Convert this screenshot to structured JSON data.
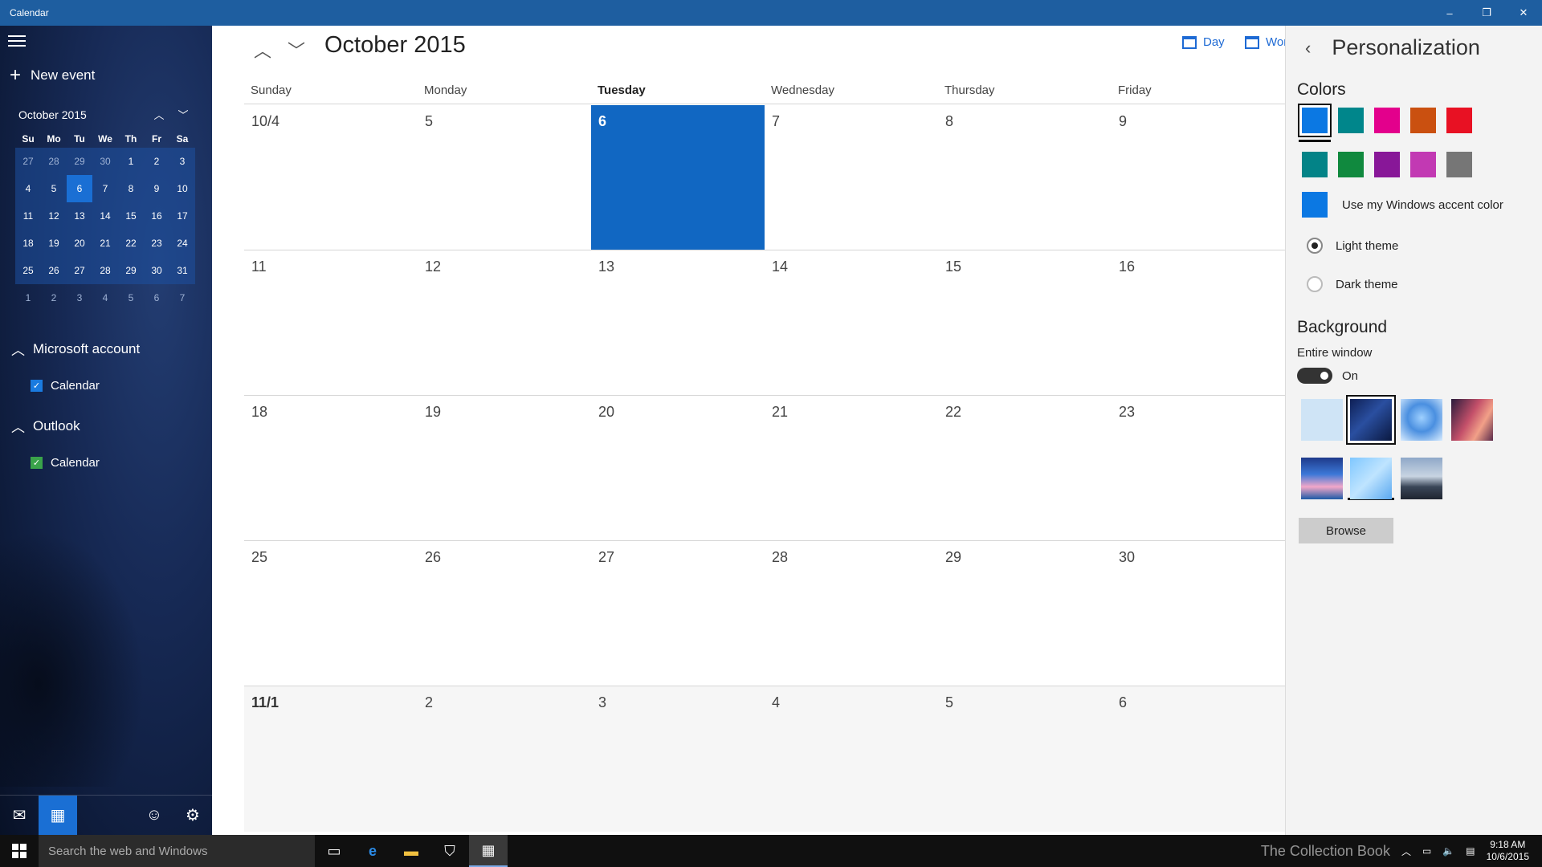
{
  "window": {
    "title": "Calendar",
    "minimize": "–",
    "restore": "❐",
    "close": "✕"
  },
  "sidebar": {
    "new_event": "New event",
    "mini_month": "October 2015",
    "dow": [
      "Su",
      "Mo",
      "Tu",
      "We",
      "Th",
      "Fr",
      "Sa"
    ],
    "weeks": [
      [
        "27",
        "28",
        "29",
        "30",
        "1",
        "2",
        "3"
      ],
      [
        "4",
        "5",
        "6",
        "7",
        "8",
        "9",
        "10"
      ],
      [
        "11",
        "12",
        "13",
        "14",
        "15",
        "16",
        "17"
      ],
      [
        "18",
        "19",
        "20",
        "21",
        "22",
        "23",
        "24"
      ],
      [
        "25",
        "26",
        "27",
        "28",
        "29",
        "30",
        "31"
      ],
      [
        "1",
        "2",
        "3",
        "4",
        "5",
        "6",
        "7"
      ]
    ],
    "accounts": [
      {
        "name": "Microsoft account",
        "calendar": "Calendar",
        "color": "#1a7be0"
      },
      {
        "name": "Outlook",
        "calendar": "Calendar",
        "color": "#3aa34a"
      }
    ]
  },
  "main": {
    "month_title": "October 2015",
    "views": {
      "day": "Day",
      "workweek": "Wor"
    },
    "dow": [
      "Sunday",
      "Monday",
      "Tuesday",
      "Wednesday",
      "Thursday",
      "Friday"
    ],
    "weeks": [
      [
        "10/4",
        "5",
        "6",
        "7",
        "8",
        "9"
      ],
      [
        "11",
        "12",
        "13",
        "14",
        "15",
        "16"
      ],
      [
        "18",
        "19",
        "20",
        "21",
        "22",
        "23"
      ],
      [
        "25",
        "26",
        "27",
        "28",
        "29",
        "30"
      ],
      [
        "11/1",
        "2",
        "3",
        "4",
        "5",
        "6"
      ]
    ],
    "today_color": "#1167c2"
  },
  "personalization": {
    "title": "Personalization",
    "colors_label": "Colors",
    "colors": [
      "#0b78e3",
      "#00868b",
      "#e3008c",
      "#ca5010",
      "#e81123",
      "#038387",
      "#10893e",
      "#881798",
      "#c239b3",
      "#767676"
    ],
    "accent_label": "Use my Windows accent color",
    "light_theme": "Light theme",
    "dark_theme": "Dark theme",
    "background_label": "Background",
    "entire_window": "Entire window",
    "toggle_state": "On",
    "browse": "Browse"
  },
  "taskbar": {
    "search_placeholder": "Search the web and Windows",
    "watermark": "The Collection Book",
    "time": "9:18 AM",
    "date": "10/6/2015"
  }
}
